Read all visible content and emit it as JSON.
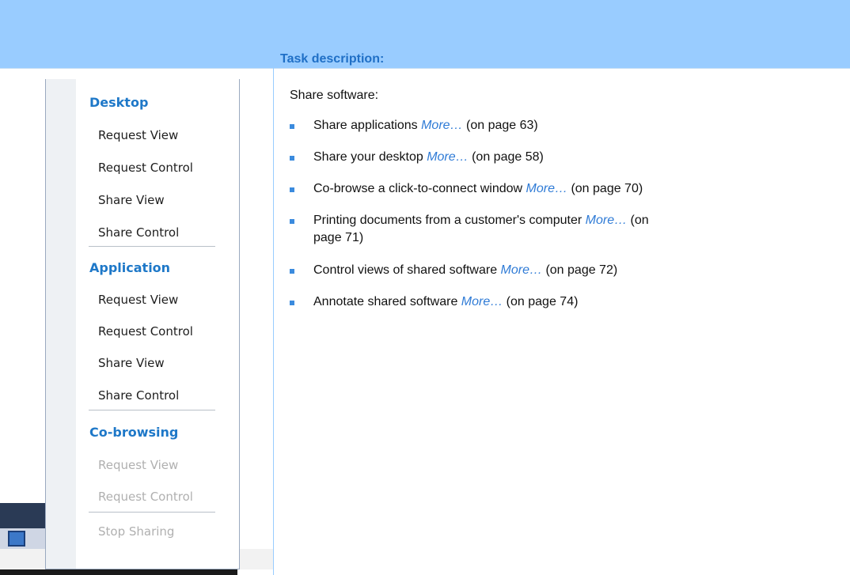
{
  "header": {
    "task_description": "Task description:"
  },
  "intro": "Share software:",
  "tasks": [
    {
      "text": "Share applications ",
      "link": "More…",
      "page_ref": " (on page 63)"
    },
    {
      "text": "Share your desktop ",
      "link": "More…",
      "page_ref": " (on page 58)"
    },
    {
      "text": "Co-browse a click-to-connect window ",
      "link": "More…",
      "page_ref": " (on page 70)"
    },
    {
      "text": "Printing documents from a customer's computer ",
      "link": "More…",
      "page_ref": " (on page 71)"
    },
    {
      "text": "Control views of shared software ",
      "link": "More…",
      "page_ref": " (on page 72)"
    },
    {
      "text": "Annotate shared software ",
      "link": "More…",
      "page_ref": " (on page 74)"
    }
  ],
  "menu": {
    "desktop_heading": "Desktop",
    "desktop_items": [
      "Request View",
      "Request Control",
      "Share View",
      "Share Control"
    ],
    "application_heading": "Application",
    "application_items": [
      "Request View",
      "Request Control",
      "Share View",
      "Share Control"
    ],
    "cobrowsing_heading": "Co-browsing",
    "cobrowsing_items": [
      "Request View",
      "Request Control"
    ],
    "stop_sharing": "Stop Sharing"
  },
  "colors": {
    "banner": "#99ccff",
    "heading": "#1f6fc6",
    "link": "#2f7bd6",
    "bullet": "#3b8bde"
  }
}
